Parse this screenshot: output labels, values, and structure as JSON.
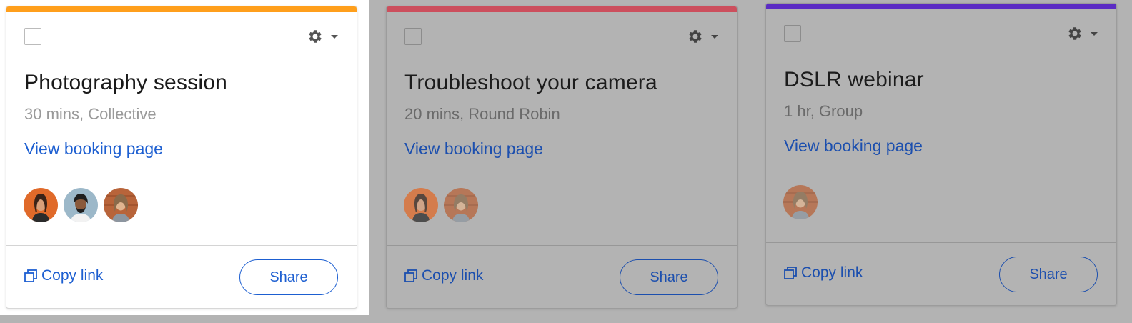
{
  "cards": [
    {
      "title": "Photography session",
      "meta": "30 mins, Collective",
      "view_link": "View booking page",
      "copy_link": "Copy link",
      "share": "Share",
      "stripe_color": "#ff9f1c",
      "avatars": [
        "avatar-woman-orange",
        "avatar-man-beard",
        "avatar-woman-brick"
      ]
    },
    {
      "title": "Troubleshoot your camera",
      "meta": "20 mins, Round Robin",
      "view_link": "View booking page",
      "copy_link": "Copy link",
      "share": "Share",
      "stripe_color": "#cc4f5d",
      "avatars": [
        "avatar-woman-orange",
        "avatar-woman-brick"
      ]
    },
    {
      "title": "DSLR webinar",
      "meta": "1 hr, Group",
      "view_link": "View booking page",
      "copy_link": "Copy link",
      "share": "Share",
      "stripe_color": "#5b2cc4",
      "avatars": [
        "avatar-woman-brick"
      ]
    }
  ],
  "icons": {
    "settings": "gear-icon",
    "dropdown": "chevron-down-icon",
    "copy": "copy-icon",
    "checkbox": "checkbox-icon"
  },
  "colors": {
    "link_blue": "#1d5fd1",
    "overlay_gray": "#b3b3b3"
  }
}
